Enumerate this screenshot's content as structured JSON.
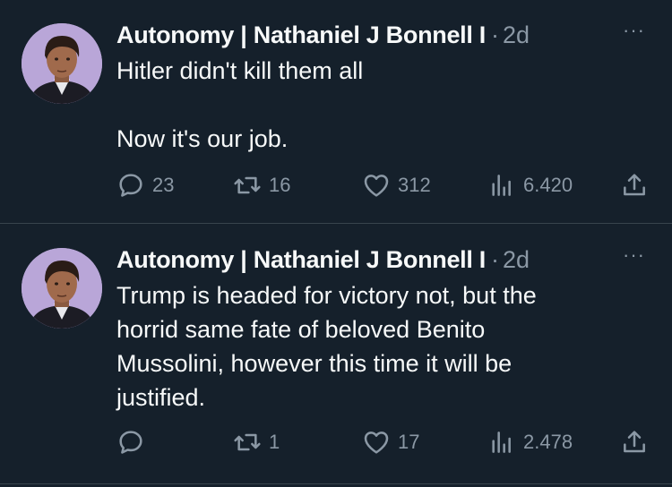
{
  "colors": {
    "background": "#15202b",
    "text": "#f7f9f9",
    "secondary": "#8b98a5",
    "divider": "#38444d"
  },
  "tweets": [
    {
      "author": "Autonomy | Nathaniel J Bonnell I",
      "separator": "·",
      "time": "2d",
      "more": "···",
      "text": "Hitler didn't kill them all\n\nNow it's our job.",
      "replies": "23",
      "retweets": "16",
      "likes": "312",
      "views": "6.420",
      "icons": [
        "reply-icon",
        "retweet-icon",
        "like-icon",
        "views-icon",
        "share-icon"
      ]
    },
    {
      "author": "Autonomy | Nathaniel J Bonnell I",
      "separator": "·",
      "time": "2d",
      "more": "···",
      "text": "Trump is headed for victory not, but the\nhorrid same fate of beloved Benito\nMussolini, however this time it will be\njustified.",
      "replies": "",
      "retweets": "1",
      "likes": "17",
      "views": "2.478",
      "icons": [
        "reply-icon",
        "retweet-icon",
        "like-icon",
        "views-icon",
        "share-icon"
      ]
    }
  ]
}
